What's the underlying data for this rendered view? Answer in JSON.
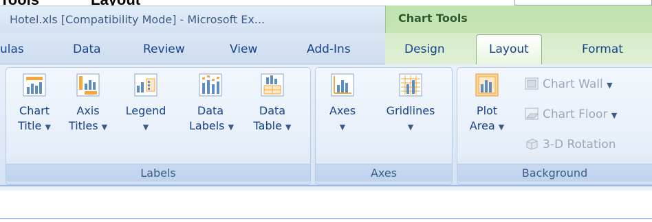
{
  "caption": {
    "left": "Tools",
    "right": "Layout"
  },
  "window": {
    "title": "Hotel.xls  [Compatibility Mode] - Microsoft Ex...",
    "context_tab_group": "Chart Tools"
  },
  "tabs": [
    {
      "label": "ulas",
      "active": false
    },
    {
      "label": "Data",
      "active": false
    },
    {
      "label": "Review",
      "active": false
    },
    {
      "label": "View",
      "active": false
    },
    {
      "label": "Add-Ins",
      "active": false
    },
    {
      "label": "Design",
      "active": false
    },
    {
      "label": "Layout",
      "active": true
    },
    {
      "label": "Format",
      "active": false
    }
  ],
  "groups": {
    "labels": {
      "title": "Labels",
      "buttons": [
        {
          "line1": "Chart",
          "line2": "Title",
          "icon": "chart-title-icon"
        },
        {
          "line1": "Axis",
          "line2": "Titles",
          "icon": "axis-titles-icon"
        },
        {
          "line1": "Legend",
          "line2": "",
          "icon": "legend-icon"
        },
        {
          "line1": "Data",
          "line2": "Labels",
          "icon": "data-labels-icon"
        },
        {
          "line1": "Data",
          "line2": "Table",
          "icon": "data-table-icon"
        }
      ]
    },
    "axes": {
      "title": "Axes",
      "buttons": [
        {
          "line1": "Axes",
          "line2": "",
          "icon": "axes-icon"
        },
        {
          "line1": "Gridlines",
          "line2": "",
          "icon": "gridlines-icon"
        }
      ]
    },
    "background": {
      "title": "Background",
      "plot_area": {
        "line1": "Plot",
        "line2": "Area",
        "icon": "plot-area-icon"
      },
      "small_buttons": [
        {
          "label": "Chart Wall",
          "icon": "chart-wall-icon",
          "dropdown": true
        },
        {
          "label": "Chart Floor",
          "icon": "chart-floor-icon",
          "dropdown": true
        },
        {
          "label": "3-D Rotation",
          "icon": "rotation-3d-icon",
          "dropdown": false
        }
      ]
    }
  },
  "colors": {
    "accent_green": "#c6e5b6",
    "ribbon_blue": "#dde8f6",
    "text_blue": "#15428b",
    "icon_orange": "#f2a83b"
  }
}
